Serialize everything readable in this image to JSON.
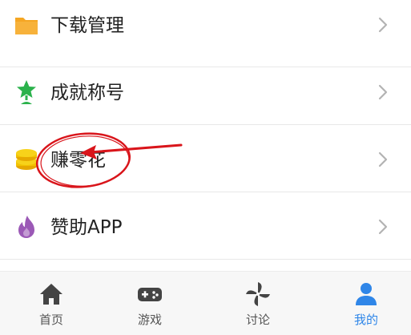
{
  "menu": {
    "items": [
      {
        "label": "下载管理",
        "icon": "folder-icon",
        "color": "#f5a623"
      },
      {
        "label": "成就称号",
        "icon": "trophy-star-icon",
        "color": "#2bb24c"
      },
      {
        "label": "赚零花",
        "icon": "coin-stack-icon",
        "color": "#f2c200"
      },
      {
        "label": "赞助APP",
        "icon": "flame-icon",
        "color": "#9b59b6"
      }
    ]
  },
  "tabbar": {
    "tabs": [
      {
        "label": "首页",
        "icon": "home-icon"
      },
      {
        "label": "游戏",
        "icon": "gamepad-icon"
      },
      {
        "label": "讨论",
        "icon": "pinwheel-icon"
      },
      {
        "label": "我的",
        "icon": "user-icon",
        "active": true
      }
    ],
    "active_color": "#2f86e8",
    "inactive_color": "#444444"
  },
  "annotation": {
    "color": "#d9151b",
    "icon": "red-arrow-circle-annotation"
  }
}
